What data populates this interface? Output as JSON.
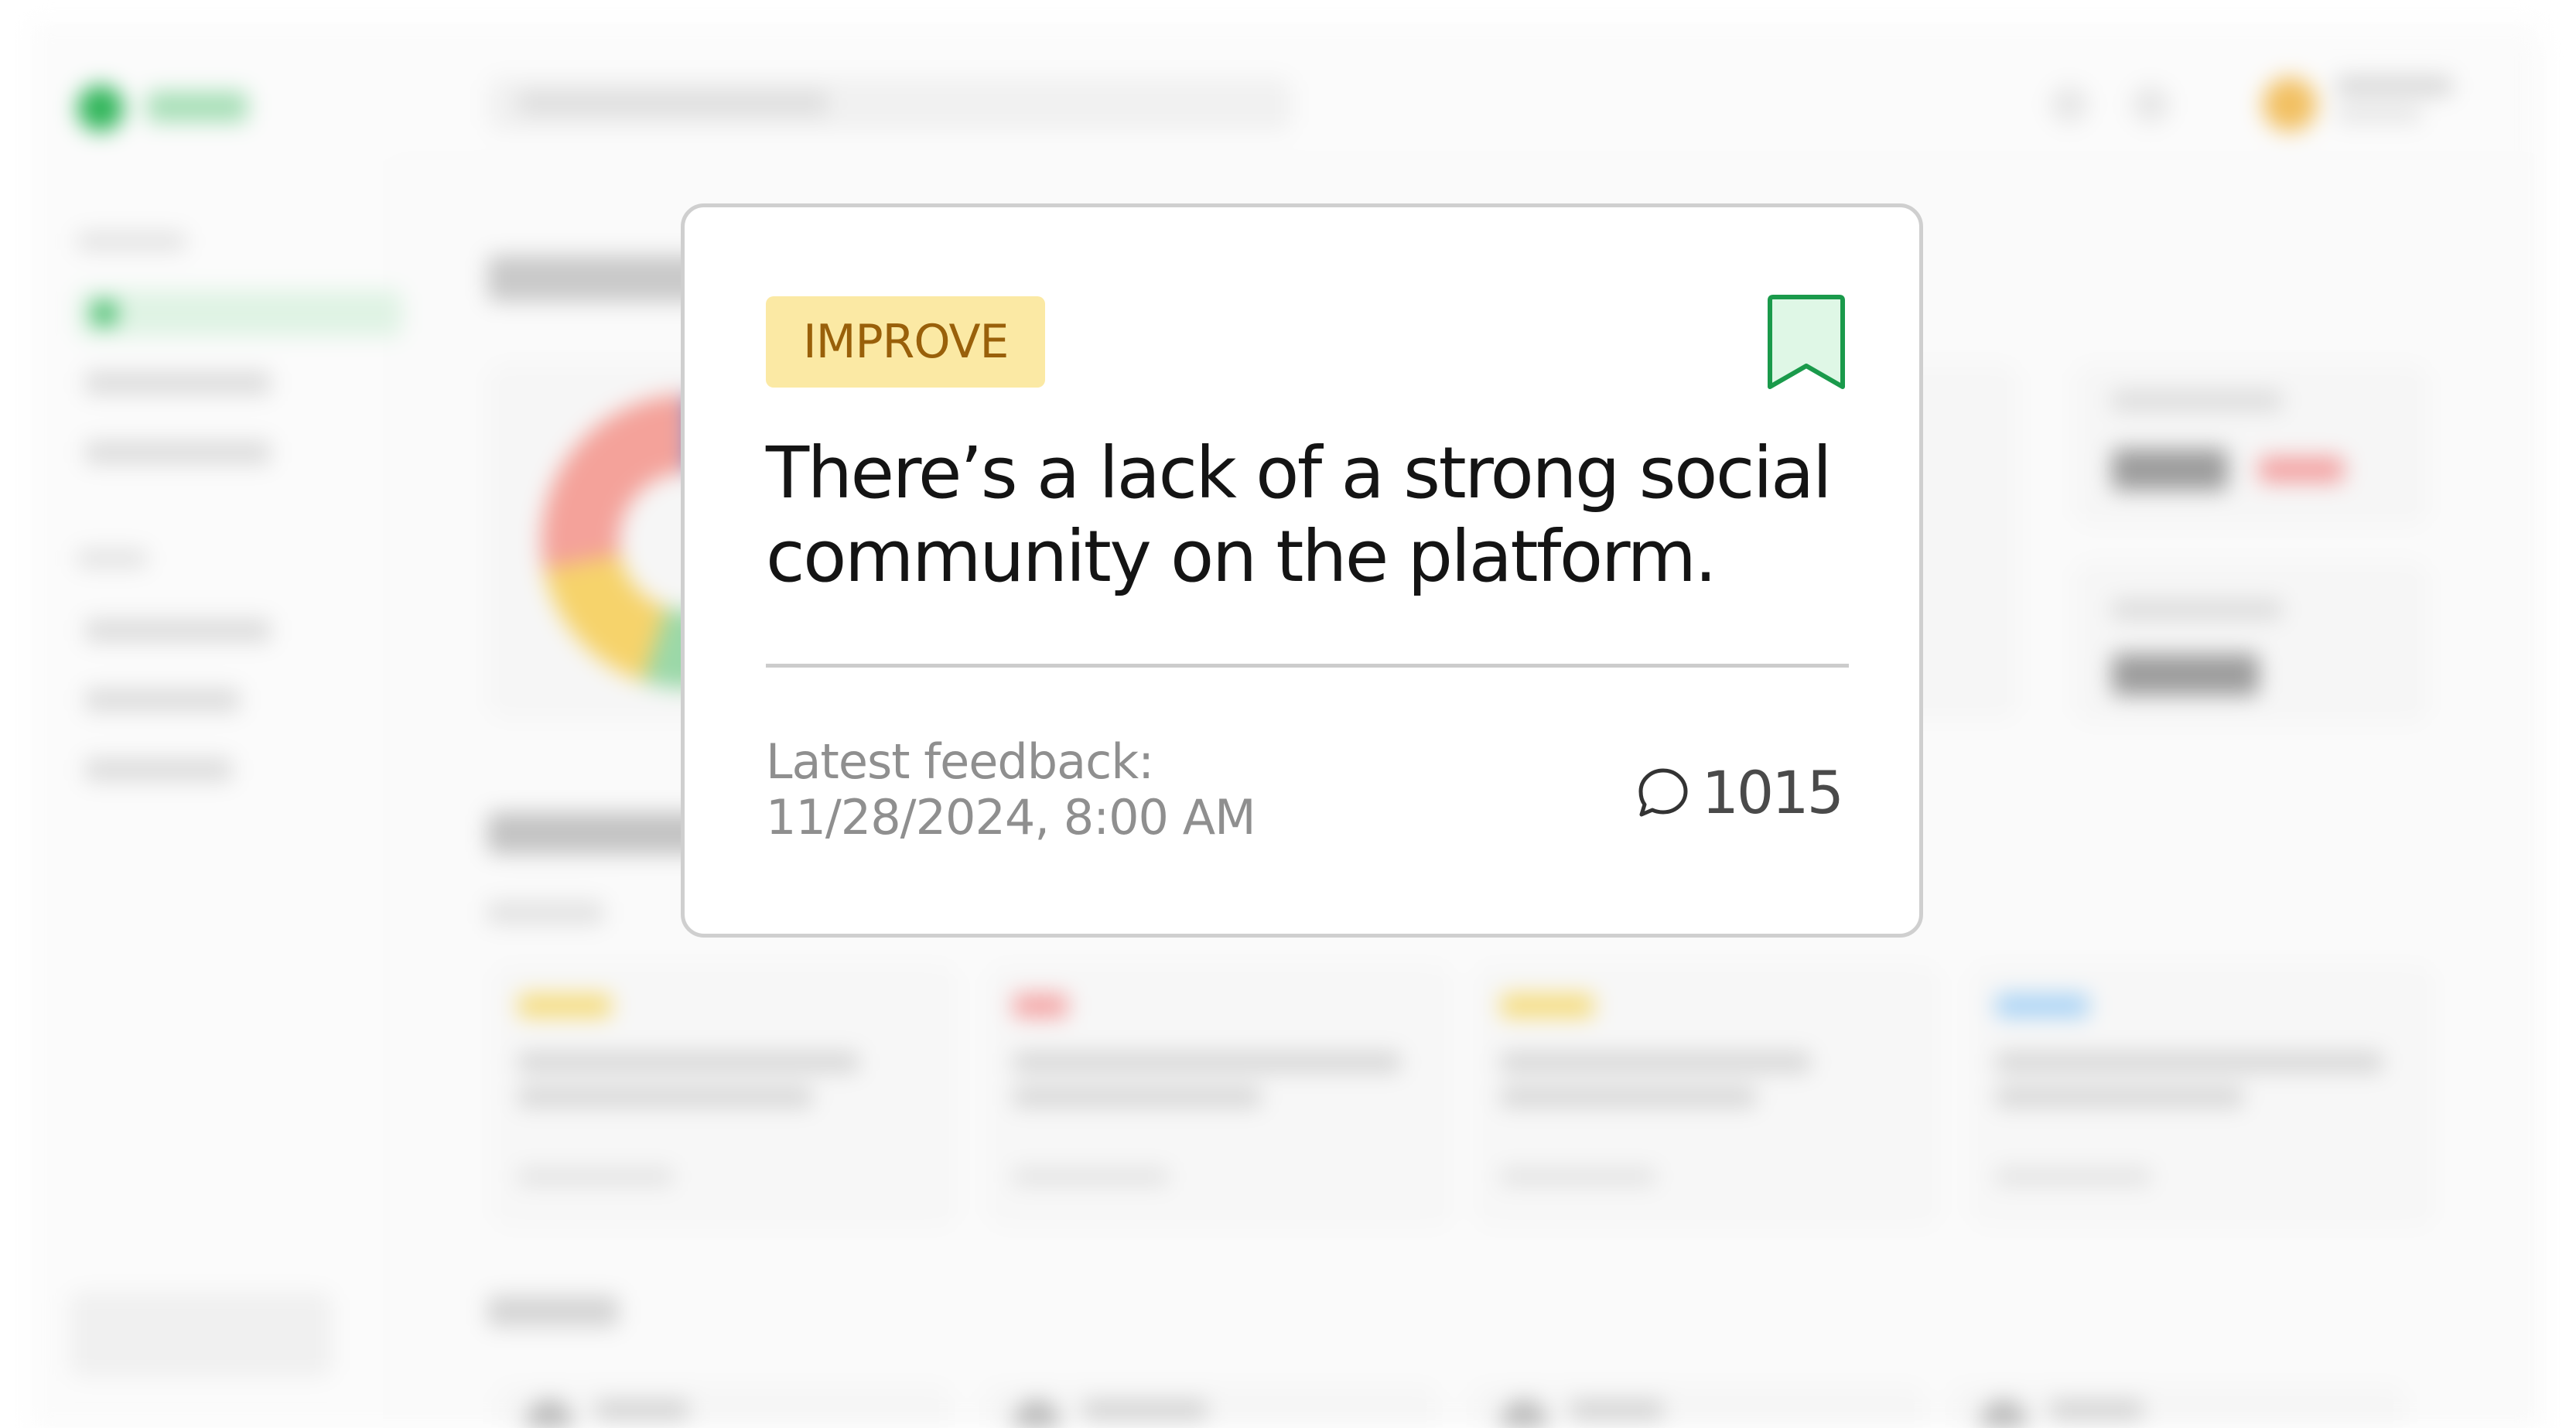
{
  "card": {
    "tag": "IMPROVE",
    "title": "There’s a lack of a strong social community on the platform.",
    "feedback_label": "Latest feedback:",
    "feedback_time": "11/28/2024, 8:00 AM",
    "comment_count": "1015",
    "icons": {
      "bookmark": "bookmark-icon",
      "comment": "comment-bubble-icon"
    }
  },
  "colors": {
    "tag_bg": "#fbe9a4",
    "tag_text": "#99600a",
    "bookmark_stroke": "#1a9a4b",
    "bookmark_fill": "#dff7e6",
    "card_border": "#cfcfcf"
  }
}
